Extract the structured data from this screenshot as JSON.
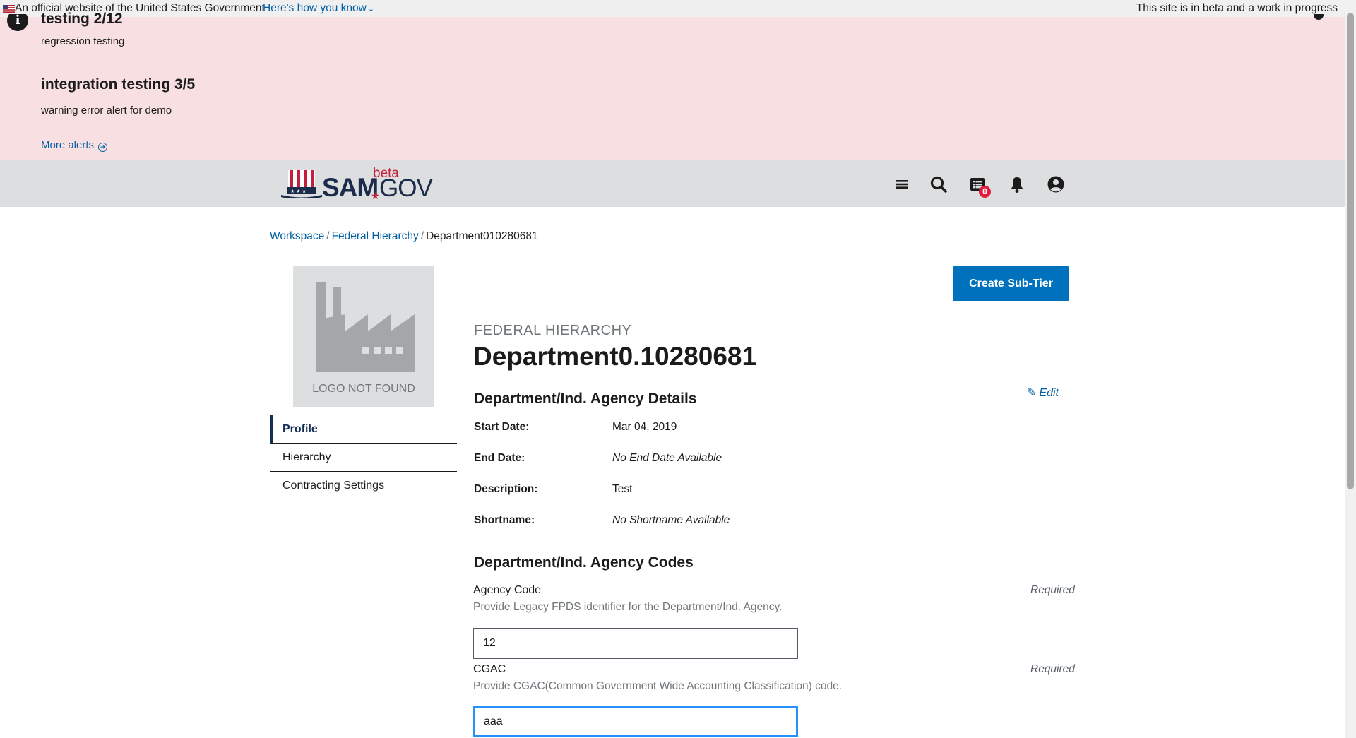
{
  "gov_banner": {
    "official_text": "An official website of the United States Government",
    "how_link": "Here's how you know",
    "beta_text": "This site is in beta and a work in progress"
  },
  "alerts": {
    "items": [
      {
        "title": "testing 2/12",
        "body": "regression testing"
      },
      {
        "title": "integration testing 3/5",
        "body": "warning error alert for demo"
      }
    ],
    "more_link": "More alerts"
  },
  "header": {
    "logo": {
      "sam": "SAM",
      "beta": "beta",
      "gov": "GOV"
    },
    "notification_count": "0",
    "icons": [
      "menu-icon",
      "search-icon",
      "messages-icon",
      "bell-icon",
      "user-icon"
    ]
  },
  "breadcrumb": [
    {
      "label": "Workspace"
    },
    {
      "label": "Federal Hierarchy"
    },
    {
      "label": "Department010280681"
    }
  ],
  "org_logo": {
    "caption": "LOGO NOT FOUND"
  },
  "sidenav": [
    "Profile",
    "Hierarchy",
    "Contracting Settings"
  ],
  "actions": {
    "create_subtier": "Create Sub-Tier",
    "edit": "Edit"
  },
  "page": {
    "eyebrow": "FEDERAL HIERARCHY",
    "title": "Department0.10280681"
  },
  "details": {
    "title": "Department/Ind. Agency Details",
    "rows": [
      {
        "label": "Start Date:",
        "value": "Mar 04, 2019"
      },
      {
        "label": "End Date:",
        "value": "No End Date Available"
      },
      {
        "label": "Description:",
        "value": "Test"
      },
      {
        "label": "Shortname:",
        "value": "No Shortname Available"
      }
    ]
  },
  "codes": {
    "title": "Department/Ind. Agency Codes",
    "agency_code": {
      "label": "Agency Code",
      "required": "Required",
      "help": "Provide Legacy FPDS identifier for the Department/Ind. Agency.",
      "value": "12"
    },
    "cgac": {
      "label": "CGAC",
      "required": "Required",
      "help": "Provide CGAC(Common Government Wide Accounting Classification) code.",
      "value": "aaa"
    }
  },
  "colors": {
    "alert_bg": "#f8dfe1",
    "header_bg": "#dcdee0",
    "primary": "#0071bc",
    "link": "#005ea2"
  }
}
